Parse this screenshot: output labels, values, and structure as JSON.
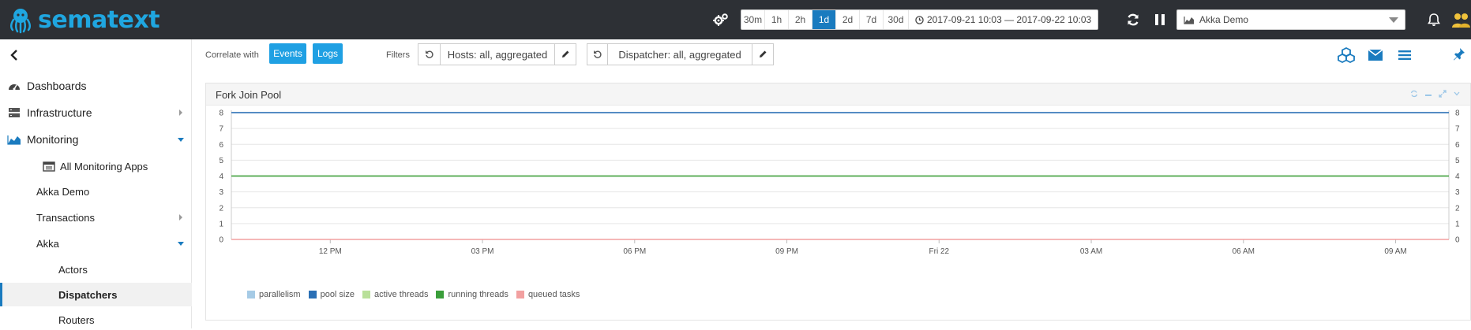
{
  "brand": {
    "name": "sematext",
    "color": "#1fa6e0"
  },
  "topbar": {
    "time_buttons": [
      {
        "label": "30m",
        "active": false
      },
      {
        "label": "1h",
        "active": false
      },
      {
        "label": "2h",
        "active": false
      },
      {
        "label": "1d",
        "active": true
      },
      {
        "label": "2d",
        "active": false
      },
      {
        "label": "7d",
        "active": false
      },
      {
        "label": "30d",
        "active": false
      }
    ],
    "time_range": "2017-09-21 10:03 — 2017-09-22 10:03",
    "app_select": "Akka Demo"
  },
  "sidebar": {
    "items": [
      {
        "label": "Dashboards",
        "icon": "dashboard-icon"
      },
      {
        "label": "Infrastructure",
        "icon": "server-icon"
      },
      {
        "label": "Monitoring",
        "icon": "area-chart-icon"
      },
      {
        "label": "All Monitoring Apps",
        "icon": "apps-list-icon"
      },
      {
        "label": "Akka Demo"
      },
      {
        "label": "Transactions"
      },
      {
        "label": "Akka"
      },
      {
        "label": "Actors"
      },
      {
        "label": "Dispatchers"
      },
      {
        "label": "Routers"
      }
    ]
  },
  "toolbar": {
    "correlate_label": "Correlate with",
    "events_label": "Events",
    "logs_label": "Logs",
    "filters_label": "Filters",
    "hosts_filter": "Hosts: all, aggregated",
    "dispatcher_filter": "Dispatcher: all, aggregated"
  },
  "panel": {
    "title": "Fork Join Pool"
  },
  "chart_data": {
    "type": "line",
    "title": "",
    "xlabel": "",
    "ylabel": "",
    "ylim": [
      0,
      8
    ],
    "y_ticks": [
      0,
      1,
      2,
      3,
      4,
      5,
      6,
      7,
      8
    ],
    "x_tick_labels": [
      "12 PM",
      "03 PM",
      "06 PM",
      "09 PM",
      "Fri 22",
      "03 AM",
      "06 AM",
      "09 AM"
    ],
    "x_range": [
      "2017-09-21 10:03",
      "2017-09-22 10:03"
    ],
    "x_ticks": [
      "2017-09-21 12:00",
      "2017-09-21 15:00",
      "2017-09-21 18:00",
      "2017-09-21 21:00",
      "2017-09-22 00:00",
      "2017-09-22 03:00",
      "2017-09-22 06:00",
      "2017-09-22 09:00"
    ],
    "grid": true,
    "legend_position": "bottom-left",
    "series": [
      {
        "name": "parallelism",
        "color": "#a6cbe6",
        "x": [
          "2017-09-21 10:03",
          "2017-09-22 10:03"
        ],
        "values": [
          8,
          8
        ]
      },
      {
        "name": "pool size",
        "color": "#2a6fb5",
        "x": [
          "2017-09-21 10:03",
          "2017-09-22 10:03"
        ],
        "values": [
          8,
          8
        ]
      },
      {
        "name": "active threads",
        "color": "#b9e09a",
        "x": [
          "2017-09-21 10:03",
          "2017-09-22 10:03"
        ],
        "values": [
          4,
          4
        ]
      },
      {
        "name": "running threads",
        "color": "#3a9e3a",
        "x": [
          "2017-09-21 10:03",
          "2017-09-22 10:03"
        ],
        "values": [
          4,
          4
        ]
      },
      {
        "name": "queued tasks",
        "color": "#f2a0a0",
        "x": [
          "2017-09-21 10:03",
          "2017-09-22 10:03"
        ],
        "values": [
          0,
          0
        ]
      }
    ]
  }
}
